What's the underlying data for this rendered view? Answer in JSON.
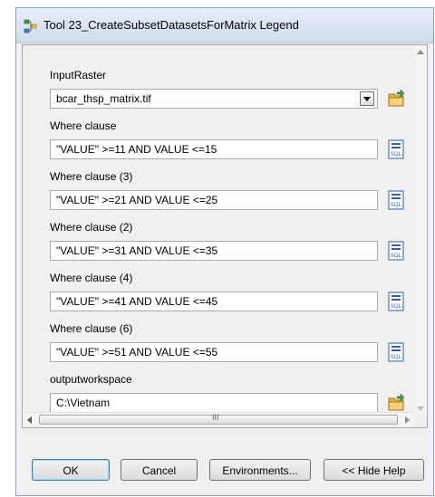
{
  "window": {
    "title": "Tool 23_CreateSubsetDatasetsForMatrix Legend"
  },
  "params": [
    {
      "label": "InputRaster",
      "value": "bcar_thsp_matrix.tif",
      "kind": "dropdown",
      "button_icon": "open-folder-icon"
    },
    {
      "label": "Where clause",
      "value": "\"VALUE\" >=11 AND VALUE <=15",
      "kind": "text",
      "button_icon": "sql-icon"
    },
    {
      "label": "Where clause (3)",
      "value": "\"VALUE\" >=21 AND VALUE <=25",
      "kind": "text",
      "button_icon": "sql-icon"
    },
    {
      "label": "Where clause (2)",
      "value": "\"VALUE\" >=31 AND VALUE <=35",
      "kind": "text",
      "button_icon": "sql-icon"
    },
    {
      "label": "Where clause (4)",
      "value": "\"VALUE\" >=41 AND VALUE <=45",
      "kind": "text",
      "button_icon": "sql-icon"
    },
    {
      "label": "Where clause (6)",
      "value": "\"VALUE\" >=51 AND VALUE <=55",
      "kind": "text",
      "button_icon": "sql-icon"
    },
    {
      "label": "outputworkspace",
      "value": "C:\\Vietnam",
      "kind": "text",
      "button_icon": "open-folder-icon"
    }
  ],
  "sql_icon_text": "SQL",
  "scrollbar_grip": "III",
  "buttons": {
    "ok": "OK",
    "cancel": "Cancel",
    "environments": "Environments...",
    "hide_help": "<< Hide Help"
  },
  "colors": {
    "folder": "#e9b948",
    "sql_icon": "#2f5fa6",
    "title_icon_green": "#3b9d3b"
  }
}
